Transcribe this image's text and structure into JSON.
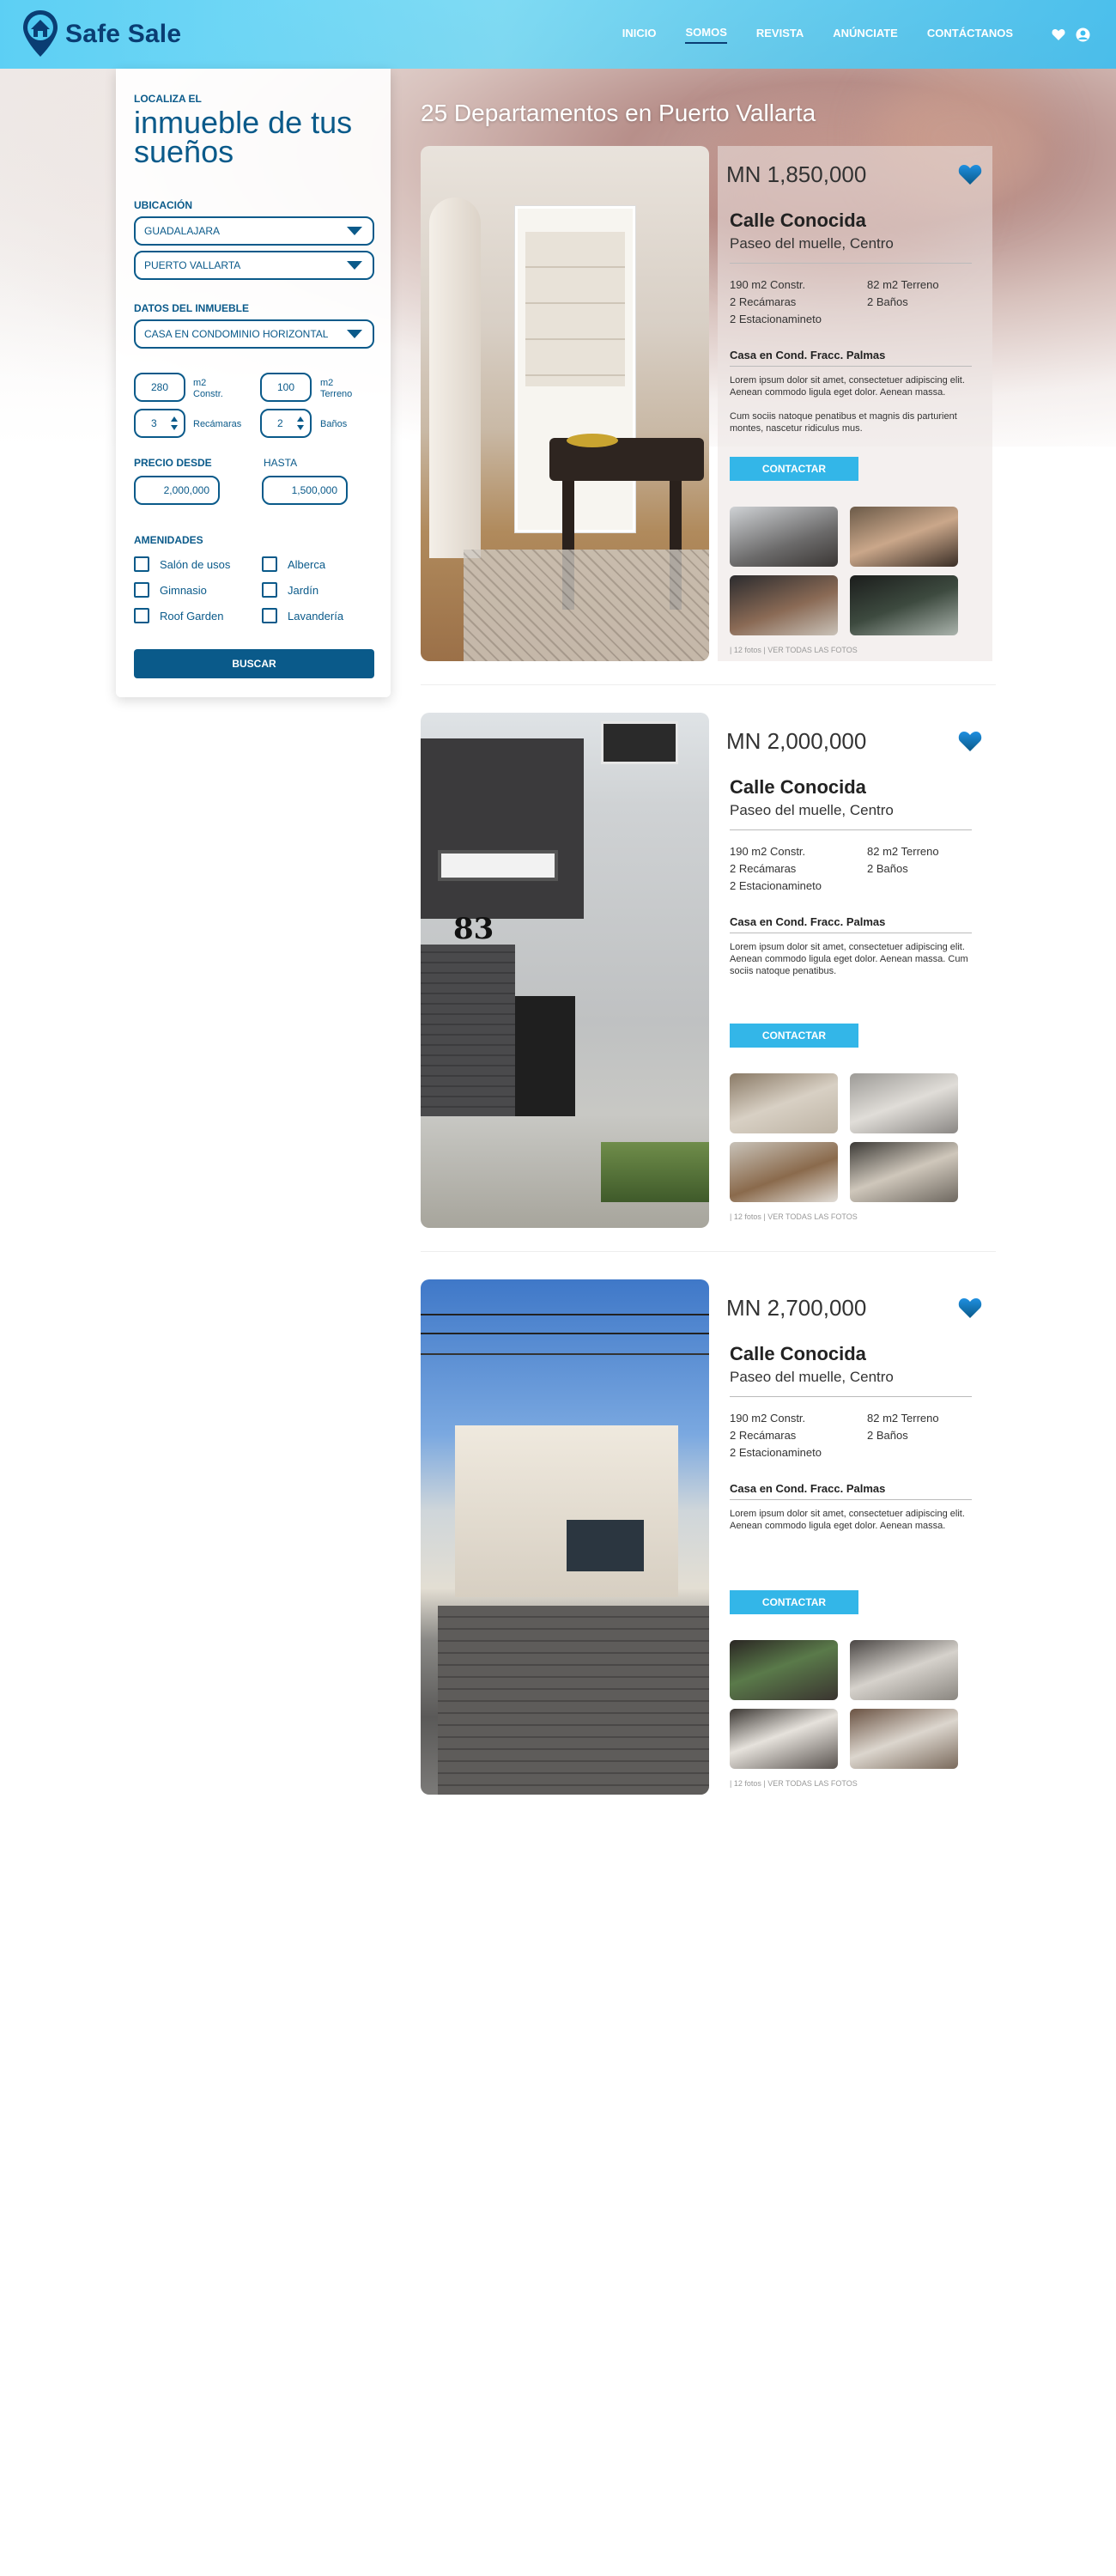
{
  "brand": {
    "name": "Safe Sale",
    "primary": "#0a5a8a",
    "accent": "#33b6e8"
  },
  "nav": {
    "items": [
      {
        "label": "INICIO"
      },
      {
        "label": "SOMOS",
        "active": true
      },
      {
        "label": "REVISTA"
      },
      {
        "label": "ANÚNCIATE"
      },
      {
        "label": "CONTÁCTANOS"
      }
    ],
    "icons": [
      "heart-icon",
      "user-icon"
    ]
  },
  "search": {
    "kicker": "LOCALIZA EL",
    "heading": "inmueble de tus sueños",
    "location_label": "UBICACIÓN",
    "state_value": "GUADALAJARA",
    "city_value": "PUERTO VALLARTA",
    "property_label": "DATOS DEL INMUEBLE",
    "type_value": "CASA EN CONDOMINIO HORIZONTAL",
    "constr_value": "280",
    "constr_unit": "m2 Constr.",
    "terreno_value": "100",
    "terreno_unit": "m2 Terreno",
    "rec_value": "3",
    "rec_unit": "Recámaras",
    "banos_value": "2",
    "banos_unit": "Baños",
    "price_from_label": "PRECIO DESDE",
    "price_to_label": "HASTA",
    "price_from": "2,000,000",
    "price_to": "1,500,000",
    "amenities_label": "AMENIDADES",
    "amenities": [
      "Salón de usos",
      "Alberca",
      "Gimnasio",
      "Jardín",
      "Roof Garden",
      "Lavandería"
    ],
    "button": "BUSCAR"
  },
  "results": {
    "title": "25 Departamentos en Puerto Vallarta",
    "listings": [
      {
        "price": "MN 1,850,000",
        "street": "Calle Conocida",
        "area": "Paseo del muelle, Centro",
        "features": [
          "190 m2 Constr.",
          "82 m2 Terreno",
          "2 Recámaras",
          "2 Baños",
          "2 Estacionamineto"
        ],
        "subtitle": "Casa en Cond. Fracc. Palmas",
        "desc": [
          "Lorem ipsum dolor sit amet, consectetuer adipiscing elit. Aenean commodo ligula eget dolor. Aenean massa.",
          "Cum sociis natoque penatibus et magnis dis parturient montes, nascetur ridiculus mus."
        ],
        "button": "CONTACTAR",
        "photos_note": "| 12 fotos | VER TODAS LAS FOTOS"
      },
      {
        "price": "MN 2,000,000",
        "street": "Calle Conocida",
        "area": "Paseo del muelle, Centro",
        "features": [
          "190 m2 Constr.",
          "82 m2 Terreno",
          "2 Recámaras",
          "2 Baños",
          "2 Estacionamineto"
        ],
        "subtitle": "Casa en Cond. Fracc. Palmas",
        "desc": [
          "Lorem ipsum dolor sit amet, consectetuer adipiscing elit. Aenean commodo ligula eget dolor. Aenean massa. Cum sociis natoque penatibus."
        ],
        "button": "CONTACTAR",
        "photos_note": "| 12 fotos | VER TODAS LAS FOTOS",
        "house_number": "83"
      },
      {
        "price": "MN 2,700,000",
        "street": "Calle Conocida",
        "area": "Paseo del muelle, Centro",
        "features": [
          "190 m2 Constr.",
          "82 m2 Terreno",
          "2 Recámaras",
          "2 Baños",
          "2 Estacionamineto"
        ],
        "subtitle": "Casa en Cond. Fracc. Palmas",
        "desc": [
          "Lorem ipsum dolor sit amet, consectetuer adipiscing elit. Aenean commodo ligula eget dolor. Aenean massa."
        ],
        "button": "CONTACTAR",
        "photos_note": "| 12 fotos | VER TODAS LAS FOTOS"
      }
    ]
  }
}
